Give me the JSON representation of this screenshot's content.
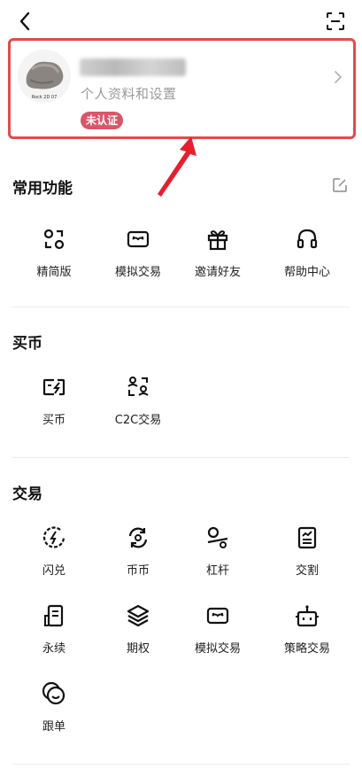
{
  "profile": {
    "subtitle": "个人资料和设置",
    "badge": "未认证",
    "avatar_caption": "Rock 2D 07"
  },
  "sections": {
    "common": {
      "title": "常用功能",
      "items": [
        "精简版",
        "模拟交易",
        "邀请好友",
        "帮助中心"
      ]
    },
    "buy": {
      "title": "买币",
      "items": [
        "买币",
        "C2C交易"
      ]
    },
    "trade": {
      "title": "交易",
      "items": [
        "闪兑",
        "币币",
        "杠杆",
        "交割",
        "永续",
        "期权",
        "模拟交易",
        "策略交易",
        "跟单"
      ]
    }
  },
  "colors": {
    "highlight_border": "#e24b4b",
    "badge_bg": "#d9566a",
    "annotation_arrow": "#e5202e"
  }
}
